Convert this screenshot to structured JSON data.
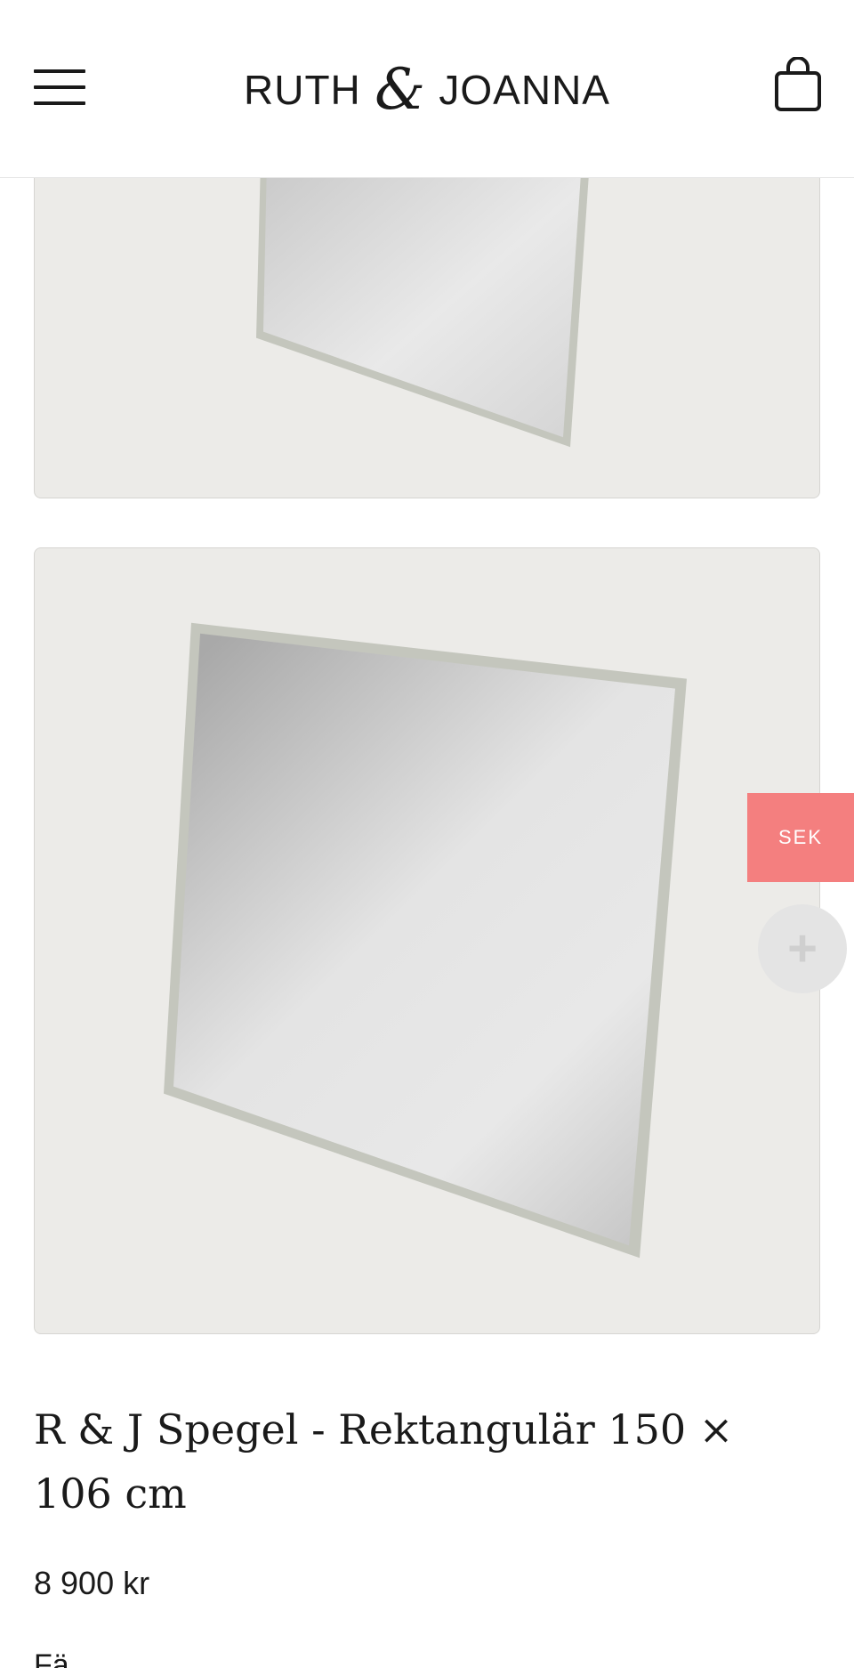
{
  "header": {
    "logo": {
      "left_word": "RUTH",
      "amp": "&",
      "right_word": "JOANNA"
    },
    "menu_icon": "hamburger-icon",
    "cart_icon": "shopping-bag-icon"
  },
  "gallery": {
    "images": [
      {
        "alt": "mirror-top-cropped"
      },
      {
        "alt": "mirror-rectangular-angled"
      }
    ]
  },
  "currency": {
    "label": "SEK"
  },
  "plus_button": {
    "icon": "plus-icon",
    "glyph": "+"
  },
  "product": {
    "title": "R & J Spegel - Rektangulär 150 × 106 cm",
    "price": "8 900 kr",
    "next_text": "Fä"
  },
  "colors": {
    "accent": "#f47f7f",
    "image_bg": "#ecebe8",
    "text": "#1a1a1a"
  }
}
